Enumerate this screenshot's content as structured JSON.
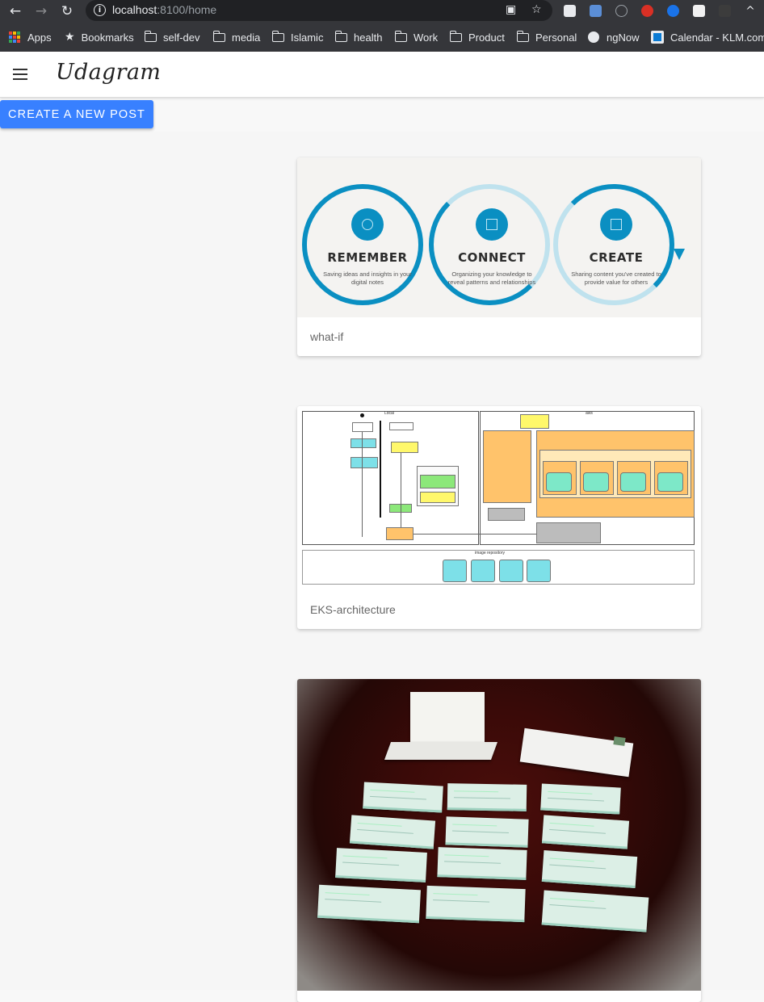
{
  "browser": {
    "url_host": "localhost",
    "url_path": ":8100/home",
    "bookmarks": [
      {
        "label": "Apps",
        "icon": "apps-grid-icon"
      },
      {
        "label": "Bookmarks",
        "icon": "star-icon"
      },
      {
        "label": "self-dev",
        "icon": "folder-icon"
      },
      {
        "label": "media",
        "icon": "folder-icon"
      },
      {
        "label": "Islamic",
        "icon": "folder-icon"
      },
      {
        "label": "health",
        "icon": "folder-icon"
      },
      {
        "label": "Work",
        "icon": "folder-icon"
      },
      {
        "label": "Product",
        "icon": "folder-icon"
      },
      {
        "label": "Personal",
        "icon": "folder-icon"
      },
      {
        "label": "ngNow",
        "icon": "globe-icon"
      },
      {
        "label": "Calendar - KLM.com",
        "icon": "klm-icon"
      }
    ]
  },
  "app": {
    "title": "Udagram",
    "create_button": "CREATE A NEW POST"
  },
  "feed": [
    {
      "caption": "what-if",
      "image": {
        "steps": [
          {
            "title": "REMEMBER",
            "subtitle": "Saving ideas and insights in your digital notes"
          },
          {
            "title": "CONNECT",
            "subtitle": "Organizing your knowledge to reveal patterns and relationships"
          },
          {
            "title": "CREATE",
            "subtitle": "Sharing content you've created to provide value for others"
          }
        ]
      }
    },
    {
      "caption": "EKS-architecture",
      "image": {
        "left_label": "Local",
        "right_label": "aws",
        "bottom_label": "image repository"
      }
    },
    {
      "caption": "",
      "image": {
        "description_icon": "cheques-photo"
      }
    }
  ],
  "colors": {
    "accent": "#3880ff",
    "chrome": "#35363a",
    "evernote_blue": "#0a8fc2"
  }
}
